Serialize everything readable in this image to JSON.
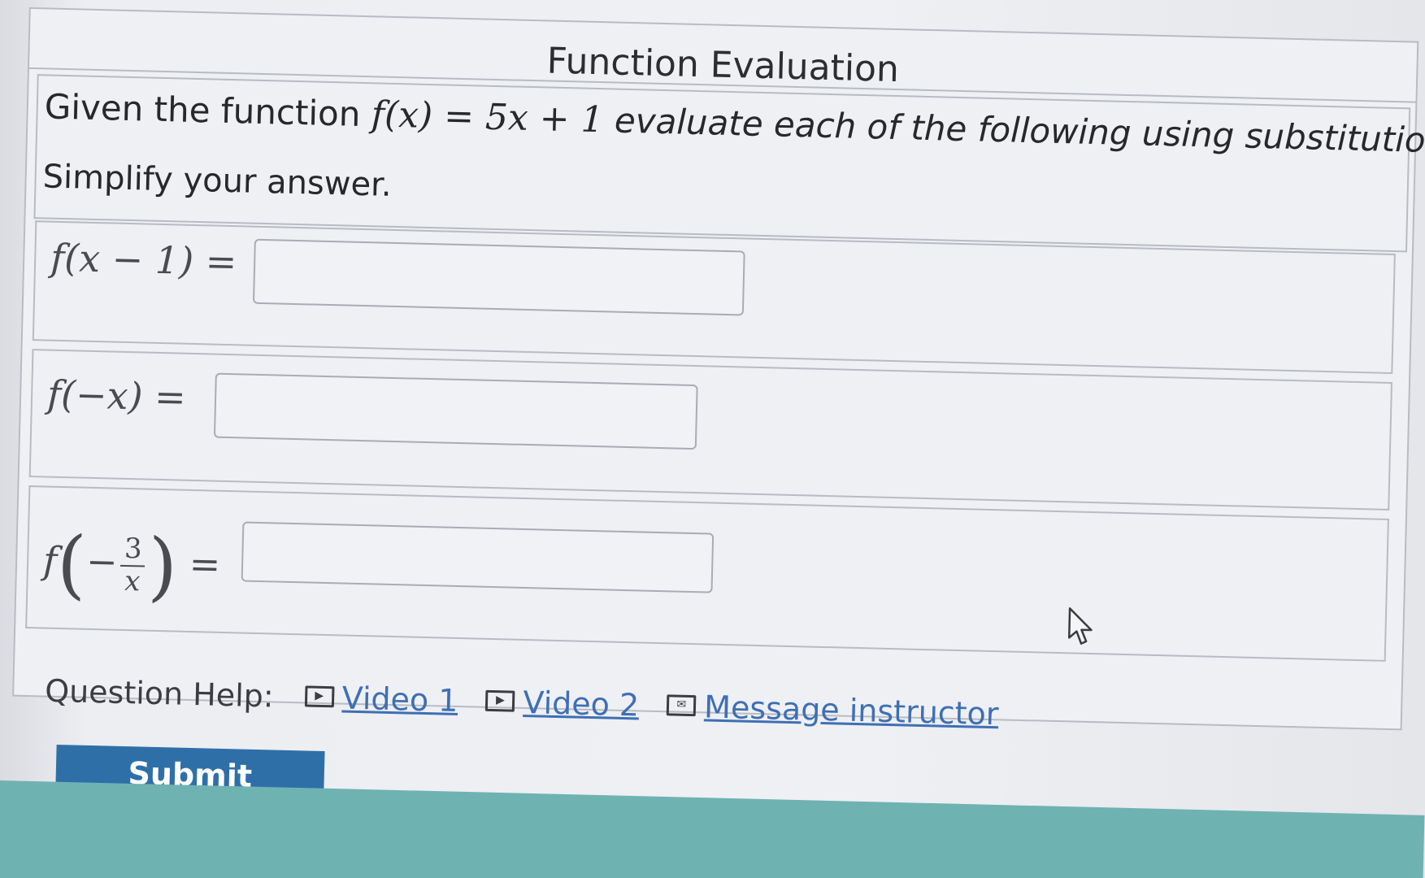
{
  "question": {
    "title": "Function Evaluation",
    "prompt_before": "Given the function ",
    "prompt_math": "f(x) = 5x + 1",
    "prompt_after": " evaluate each of the following using substitution.",
    "simplify": "Simplify your answer."
  },
  "parts": [
    {
      "label": "f(x − 1) =",
      "value": ""
    },
    {
      "label": "f(−x) =",
      "value": ""
    },
    {
      "label_prefix": "f",
      "label_fraction_num": "3",
      "label_fraction_den": "x",
      "label_suffix": "=",
      "value": ""
    }
  ],
  "help": {
    "label": "Question Help:",
    "video1": "Video 1",
    "video2": "Video 2",
    "message": "Message instructor",
    "video_icon": "play-box-icon",
    "message_icon": "envelope-icon"
  },
  "submit": {
    "label": "Submit Question"
  },
  "colors": {
    "link": "#3f6fb3",
    "submit_bg": "#2f6fa8",
    "taskbar": "#6fb2b2"
  }
}
